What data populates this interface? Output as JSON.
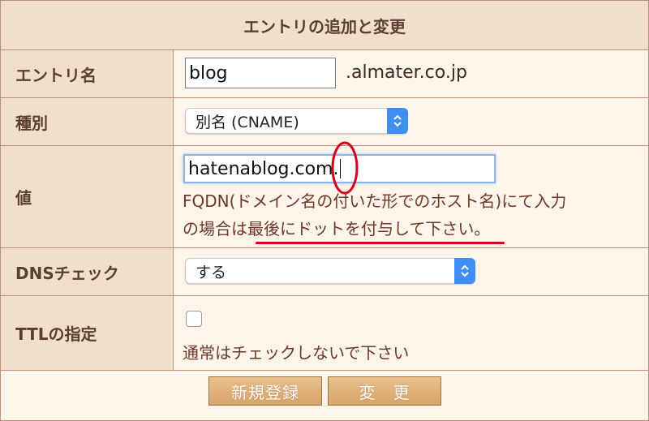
{
  "form": {
    "title": "エントリの追加と変更",
    "entry_name": {
      "label": "エントリ名",
      "value": "blog",
      "suffix": ".almater.co.jp"
    },
    "type": {
      "label": "種別",
      "selected": "別名 (CNAME)"
    },
    "value": {
      "label": "値",
      "input_value": "hatenablog.com.",
      "help_line1": "FQDN(ドメイン名の付いた形でのホスト名)にて入力",
      "help_line2_prefix": "の場合は",
      "help_line2_emphasis": "最後にドットを付与して下さい。"
    },
    "dns_check": {
      "label": "DNSチェック",
      "selected": "する"
    },
    "ttl": {
      "label": "TTLの指定",
      "checked": false,
      "note": "通常はチェックしないで下さい"
    },
    "buttons": {
      "new_label": "新規登録",
      "change_label": "変　更"
    }
  },
  "colors": {
    "header_bg": "#f1dfcc",
    "cell_bg": "#fdf4ea",
    "border": "#b8937a",
    "label_text": "#5b3f33",
    "select_accent": "#3f8ef3",
    "annotation_red": "#d9001b",
    "button": "#d6a369"
  },
  "icons": {
    "select_arrow": "chevron-updown-icon",
    "annotation": "red-ellipse-annotation",
    "underline": "red-underline-annotation"
  }
}
